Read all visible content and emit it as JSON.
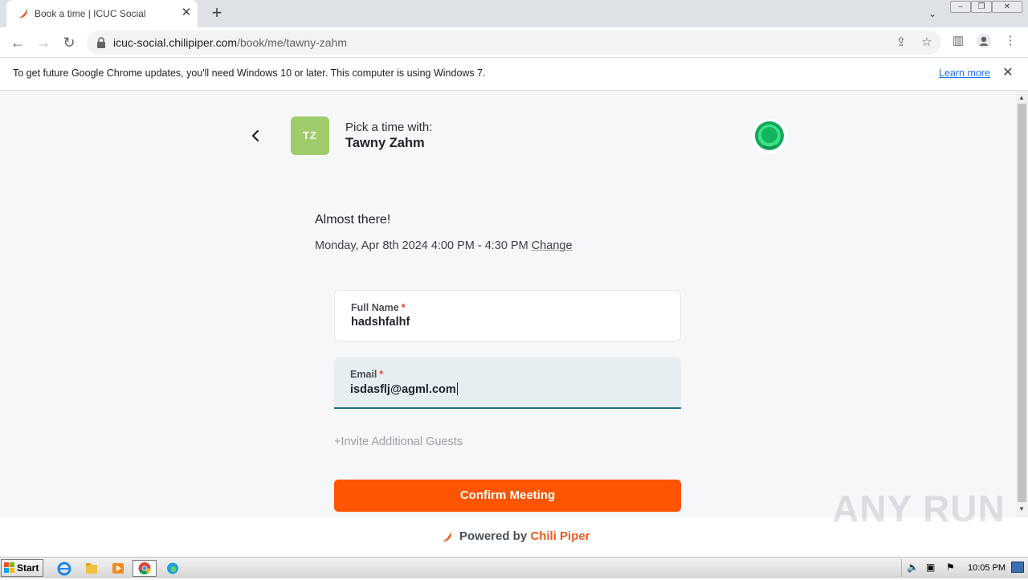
{
  "browser": {
    "tab_title": "Book a time | ICUC Social",
    "new_tab_label": "+",
    "url_host": "icuc-social.chilipiper.com",
    "url_path": "/book/me/tawny-zahm"
  },
  "infobar": {
    "message": "To get future Google Chrome updates, you'll need Windows 10 or later. This computer is using Windows 7.",
    "link_label": "Learn more"
  },
  "booking": {
    "avatar_initials": "TZ",
    "pick_label": "Pick a time with:",
    "host_name": "Tawny Zahm",
    "heading": "Almost there!",
    "selected_time": "Monday, Apr 8th 2024 4:00 PM - 4:30 PM",
    "change_label": "Change",
    "form": {
      "full_name_label": "Full Name",
      "full_name_value": "hadshfalhf",
      "email_label": "Email",
      "email_value": "isdasflj@agml.com",
      "required_mark": "*"
    },
    "invite_label": "+Invite Additional Guests",
    "confirm_label": "Confirm Meeting"
  },
  "footer": {
    "powered_by": "Powered by",
    "brand": "Chili Piper"
  },
  "watermark": "ANY RUN",
  "taskbar": {
    "start_label": "Start",
    "clock": "10:05 PM"
  },
  "colors": {
    "accent": "#ff5500",
    "avatar": "#9fcb6b",
    "email_underline": "#21707c",
    "brand_green": "#22c55e"
  }
}
